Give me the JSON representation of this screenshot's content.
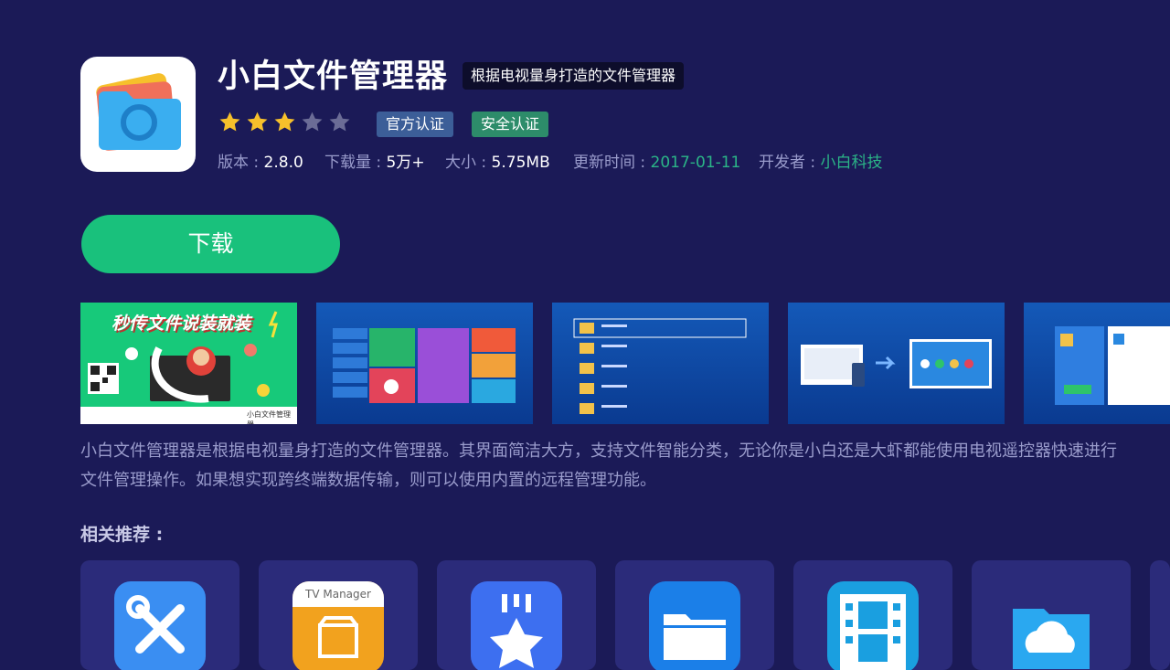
{
  "app": {
    "title": "小白文件管理器",
    "subtitle": "根据电视量身打造的文件管理器",
    "rating": 3,
    "rating_max": 5,
    "certs": [
      "官方认证",
      "安全认证"
    ],
    "meta": {
      "version_label": "版本 : ",
      "version": "2.8.0",
      "downloads_label": "下载量 : ",
      "downloads": "5万+",
      "size_label": "大小 : ",
      "size": "5.75MB",
      "updated_label": "更新时间 : ",
      "updated": "2017-01-11",
      "developer_label": "开发者 : ",
      "developer": "小白科技"
    }
  },
  "download_label": "下载",
  "screenshots": {
    "shot1_banner": "秒传文件说装就装",
    "shot1_footer": "小白文件管理器"
  },
  "description": "小白文件管理器是根据电视量身打造的文件管理器。其界面简洁大方，支持文件智能分类，无论你是小白还是大虾都能使用电视遥控器快速进行文件管理操作。如果想实现跨终端数据传输，则可以使用内置的远程管理功能。",
  "related": {
    "title": "相关推荐 :",
    "tv_manager_label": "TV Manager"
  },
  "colors": {
    "background": "#1b1a57",
    "download": "#19c17c",
    "accent_green": "#2bb587",
    "star_on": "#f6c02b",
    "star_off": "#6b6c96"
  }
}
